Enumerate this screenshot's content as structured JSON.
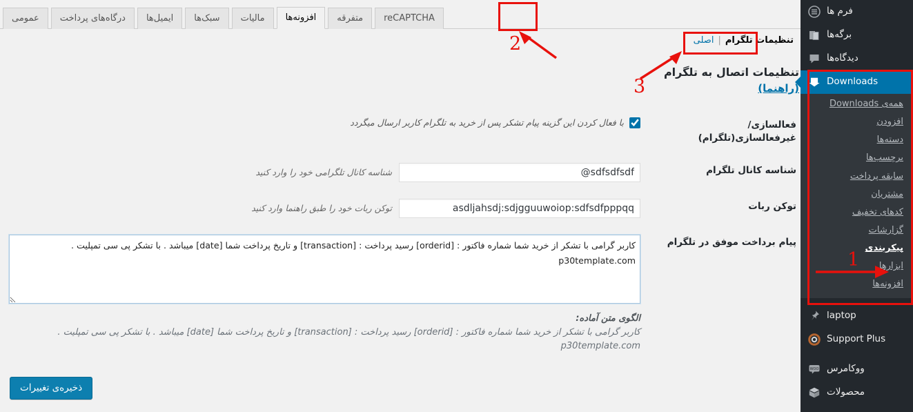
{
  "sidebar": {
    "top_items": [
      {
        "label": "فرم ها",
        "icon": "forms-icon"
      },
      {
        "label": "برگه‌ها",
        "icon": "pages-icon"
      },
      {
        "label": "دیدگاه‌ها",
        "icon": "comments-icon"
      }
    ],
    "current_item": {
      "label": "Downloads",
      "icon": "download-icon"
    },
    "sub_items": [
      {
        "label": "همه‌ی Downloads",
        "active": false
      },
      {
        "label": "افزودن",
        "active": false
      },
      {
        "label": "دسته‌ها",
        "active": false
      },
      {
        "label": "برچسب‌ها",
        "active": false
      },
      {
        "label": "سابقه پرداخت",
        "active": false
      },
      {
        "label": "مشتریان",
        "active": false
      },
      {
        "label": "کدهای تخفیف",
        "active": false
      },
      {
        "label": "گزارشات",
        "active": false
      },
      {
        "label": "پیکربندی",
        "active": true
      },
      {
        "label": "ابزارها",
        "active": false
      },
      {
        "label": "افزونه‌ها",
        "active": false
      }
    ],
    "bottom_items": [
      {
        "label": "laptop",
        "icon": "pin-icon"
      },
      {
        "label": "Support Plus",
        "icon": "lifebuoy-icon"
      },
      {
        "label": "ووکامرس",
        "icon": "woo-icon"
      },
      {
        "label": "محصولات",
        "icon": "product-box-icon"
      }
    ]
  },
  "tabs": [
    {
      "label": "reCAPTCHA",
      "active": false
    },
    {
      "label": "متفرقه",
      "active": false
    },
    {
      "label": "افزونه‌ها",
      "active": true
    },
    {
      "label": "مالیات",
      "active": false
    },
    {
      "label": "سبک‌ها",
      "active": false
    },
    {
      "label": "ایمیل‌ها",
      "active": false
    },
    {
      "label": "درگاه‌های پرداخت",
      "active": false
    },
    {
      "label": "عمومی",
      "active": false
    }
  ],
  "subnav": {
    "items": [
      {
        "label": "تنظیمات تلگرام",
        "current": true
      },
      {
        "label": "اصلی",
        "current": false
      }
    ]
  },
  "heading": {
    "title": "تنظیمات اتصال به تلگرام",
    "guide_label": "(راهنما)"
  },
  "form": {
    "rows": [
      {
        "label": "فعالسازی/ غیرفعالسازی(تلگرام)",
        "type": "checkbox",
        "checked": true,
        "description": "با فعال کردن این گزینه پیام تشکر پس از خرید به تلگرام کاربر ارسال میگردد"
      },
      {
        "label": "شناسه کانال تلگرام",
        "type": "text",
        "value": "@sdfsdfsdf",
        "hint": "شناسه کانال تلگرامی خود را وارد کنید"
      },
      {
        "label": "توکن ربات",
        "type": "text",
        "value": "asdljahsdj:sdjgguuwoiop:sdfsdfpppqq",
        "hint": "توکن ربات خود را طبق راهنما وارد کنید"
      },
      {
        "label": "پیام برداخت موفق در تلگرام",
        "type": "textarea",
        "value": "کاربر گرامی با تشکر از خرید شما شماره فاکتور : [orderid] رسید پرداخت : [transaction] و تاریخ پرداخت شما [date] میباشد . با تشکر پی سی تمپلیت .\np30template.com"
      }
    ]
  },
  "template_help": {
    "title": "الگوی متن آماده:",
    "body": "کاربر گرامی با تشکر از خرید شما شماره فاکتور : [orderid] رسید پرداخت : [transaction] و تاریخ پرداخت شما [date] میباشد . با تشکر پی سی تمپلیت .",
    "domain": "p30template.com"
  },
  "submit": {
    "label": "ذخیره‌ی تغییرات"
  },
  "annotations": {
    "marker_1": "1",
    "marker_2": "2",
    "marker_3": "3",
    "color": "#e8110c"
  },
  "colors": {
    "sidebar_bg": "#23282d",
    "submenu_bg": "#32373c",
    "accent": "#0073aa",
    "page_bg": "#f1f1f1",
    "button_primary": "#0d7faf",
    "annotation_red": "#e8110c"
  }
}
